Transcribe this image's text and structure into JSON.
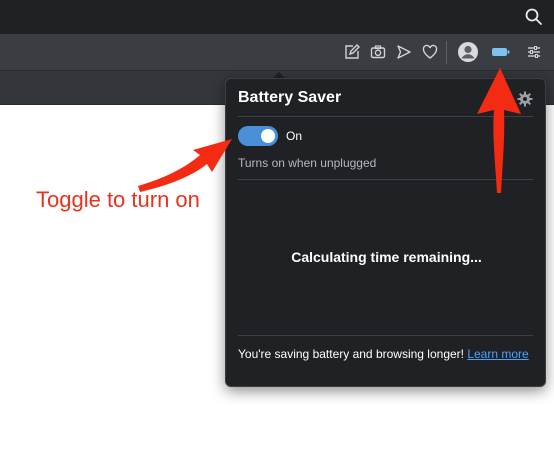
{
  "popup": {
    "title": "Battery Saver",
    "toggle_label": "On",
    "toggle_state": "on",
    "subtitle": "Turns on when unplugged",
    "status": "Calculating time remaining...",
    "footer_text": "You're saving battery and browsing longer! ",
    "footer_link": "Learn more"
  },
  "annotation": {
    "text": "Toggle to turn on"
  },
  "colors": {
    "toggle_on": "#4a90d9",
    "link": "#4aa3ff",
    "annotation": "#e8331c",
    "battery_icon": "#7dc3f0"
  },
  "icons": [
    "search-icon",
    "edit-icon",
    "camera-icon",
    "send-icon",
    "heart-icon",
    "avatar-icon",
    "battery-saver-icon",
    "settings-sliders-icon",
    "gear-icon"
  ]
}
